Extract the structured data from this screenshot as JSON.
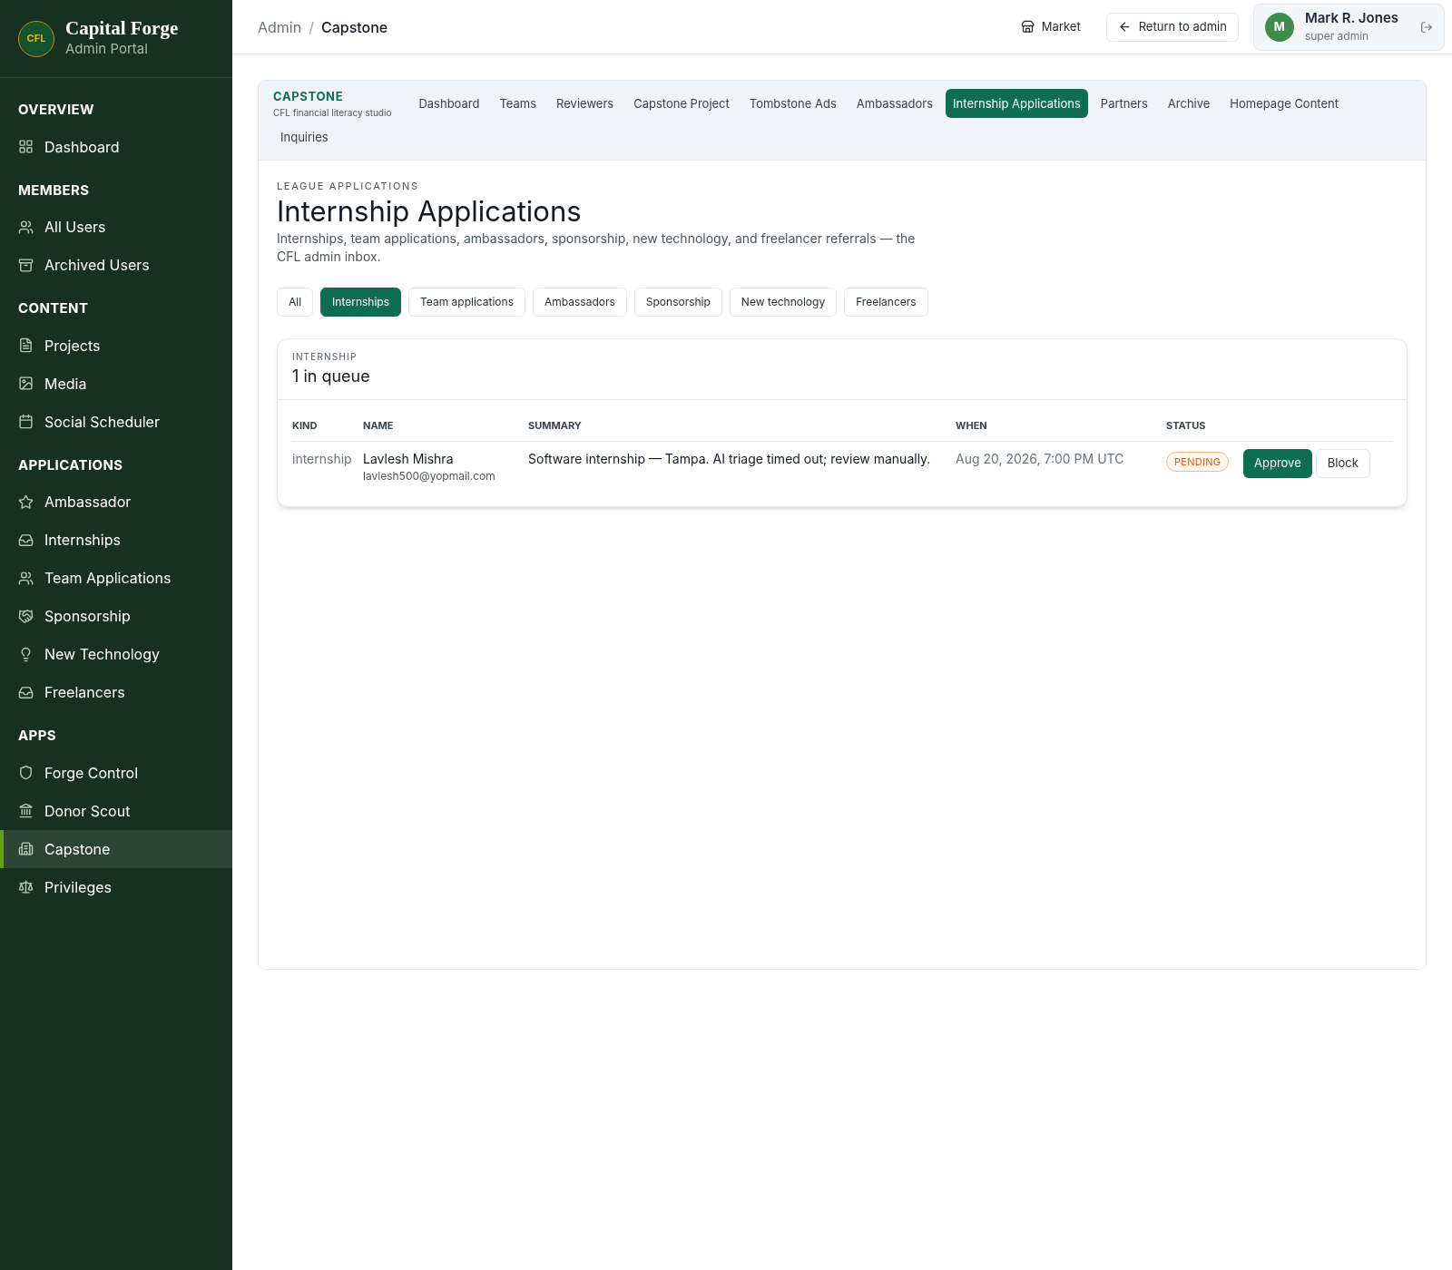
{
  "brand": {
    "logo_text": "CFL",
    "title": "Capital Forge",
    "subtitle": "Admin Portal"
  },
  "sidebar": {
    "sections": [
      {
        "heading": "OVERVIEW",
        "items": [
          {
            "label": "Dashboard",
            "selected": false
          }
        ]
      },
      {
        "heading": "MEMBERS",
        "items": [
          {
            "label": "All Users",
            "selected": false
          },
          {
            "label": "Archived Users",
            "selected": false
          }
        ]
      },
      {
        "heading": "CONTENT",
        "items": [
          {
            "label": "Projects",
            "selected": false
          },
          {
            "label": "Media",
            "selected": false
          },
          {
            "label": "Social Scheduler",
            "selected": false
          }
        ]
      },
      {
        "heading": "APPLICATIONS",
        "items": [
          {
            "label": "Ambassador",
            "selected": false
          },
          {
            "label": "Internships",
            "selected": false
          },
          {
            "label": "Team Applications",
            "selected": false
          },
          {
            "label": "Sponsorship",
            "selected": false
          },
          {
            "label": "New Technology",
            "selected": false
          },
          {
            "label": "Freelancers",
            "selected": false
          }
        ]
      },
      {
        "heading": "APPS",
        "items": [
          {
            "label": "Forge Control",
            "selected": false
          },
          {
            "label": "Donor Scout",
            "selected": false
          },
          {
            "label": "Capstone",
            "selected": true
          },
          {
            "label": "Privileges",
            "selected": false
          }
        ]
      }
    ]
  },
  "breadcrumb": [
    "Admin",
    "Capstone"
  ],
  "breadcrumb_separator": "/",
  "header": {
    "market": "Market",
    "return": "Return to admin",
    "user": {
      "initial": "M",
      "name": "Mark R. Jones",
      "role": "super admin"
    }
  },
  "app": {
    "name": "CAPSTONE",
    "tagline": "CFL financial literacy studio",
    "tabs": [
      {
        "label": "Dashboard",
        "selected": false
      },
      {
        "label": "Teams",
        "selected": false
      },
      {
        "label": "Reviewers",
        "selected": false
      },
      {
        "label": "Capstone Project",
        "selected": false
      },
      {
        "label": "Tombstone Ads",
        "selected": false
      },
      {
        "label": "Ambassadors",
        "selected": false
      },
      {
        "label": "Internship Applications",
        "selected": true
      },
      {
        "label": "Partners",
        "selected": false
      },
      {
        "label": "Archive",
        "selected": false
      },
      {
        "label": "Homepage Content",
        "selected": false
      },
      {
        "label": "Inquiries",
        "selected": false
      }
    ]
  },
  "page": {
    "eyebrow": "LEAGUE APPLICATIONS",
    "title": "Internship Applications",
    "description": "Internships, team applications, ambassadors, sponsorship, new technology, and freelancer referrals — the CFL admin inbox.",
    "filters": [
      {
        "label": "All",
        "selected": false
      },
      {
        "label": "Internships",
        "selected": true
      },
      {
        "label": "Team applications",
        "selected": false
      },
      {
        "label": "Ambassadors",
        "selected": false
      },
      {
        "label": "Sponsorship",
        "selected": false
      },
      {
        "label": "New technology",
        "selected": false
      },
      {
        "label": "Freelancers",
        "selected": false
      }
    ]
  },
  "queue": {
    "eyebrow": "INTERNSHIP",
    "count": "1 in queue",
    "table": {
      "columns": [
        "KIND",
        "NAME",
        "SUMMARY",
        "WHEN",
        "STATUS"
      ],
      "rows": [
        {
          "kind": "internship",
          "name": "Lavlesh Mishra",
          "email": "lavlesh500@yopmail.com",
          "summary": "Software internship — Tampa. AI triage timed out; review manually.",
          "when": "Aug 20, 2026, 7:00 PM UTC",
          "status": "PENDING",
          "actions": [
            "Approve",
            "Block"
          ]
        }
      ]
    }
  }
}
